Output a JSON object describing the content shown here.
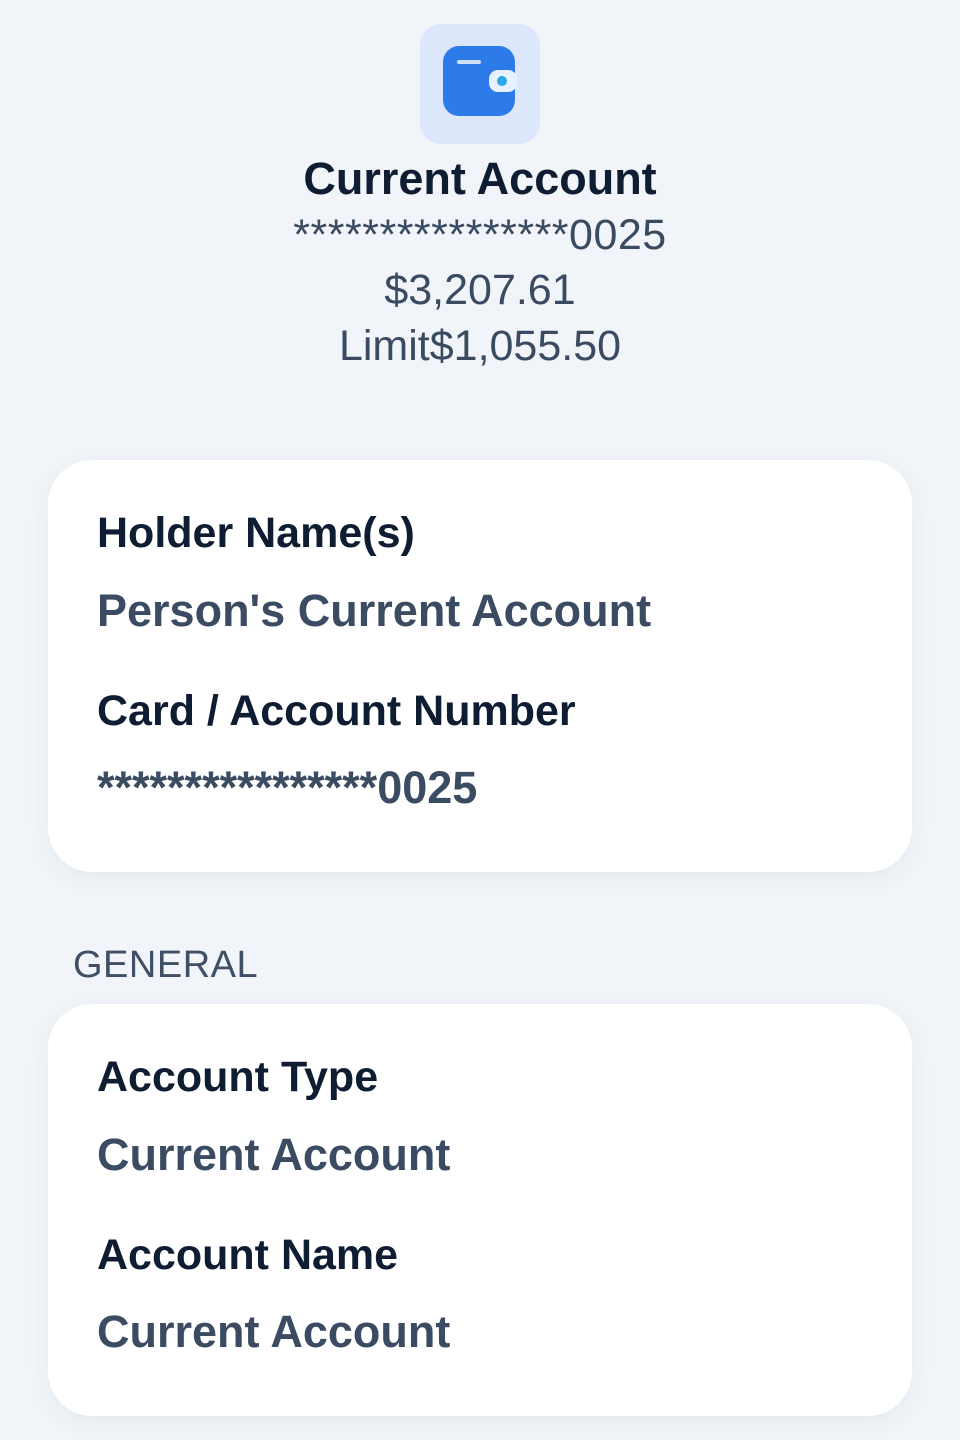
{
  "header": {
    "icon": "wallet-icon",
    "title": "Current Account",
    "masked_number": "****************0025",
    "balance": "$3,207.61",
    "limit": "Limit$1,055.50"
  },
  "holder_card": {
    "holder_label": "Holder Name(s)",
    "holder_value": "Person's Current Account",
    "number_label": "Card / Account Number",
    "number_value": "****************0025"
  },
  "general": {
    "section_label": "GENERAL",
    "type_label": "Account Type",
    "type_value": "Current Account",
    "name_label": "Account Name",
    "name_value": "Current Account"
  },
  "colors": {
    "background": "#f1f5f9",
    "icon_tile": "#dde7fb",
    "icon_blue": "#2d7be8",
    "text_dark": "#0f1d33",
    "text_muted": "#3b4b62"
  }
}
